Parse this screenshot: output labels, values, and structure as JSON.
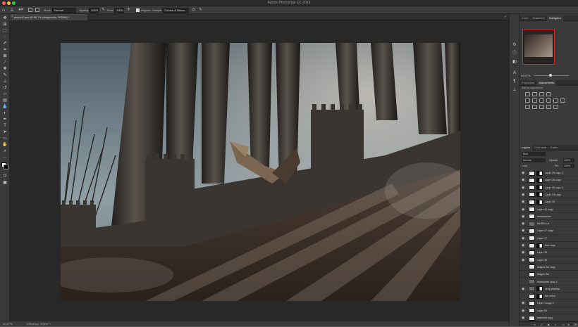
{
  "window": {
    "title": "Adobe Photoshop CC 2019",
    "traffic_colors": [
      "#ff5f57",
      "#febc2e",
      "#28c840"
    ]
  },
  "options_bar": {
    "mode_label": "Mode:",
    "mode_value": "Normal",
    "opacity_label": "Opacity:",
    "opacity_value": "100%",
    "flow_label": "Flow:",
    "flow_value": "100%",
    "aligned_label": "Aligned",
    "sample_label": "Sample:",
    "sample_value": "Current & Below"
  },
  "document": {
    "tab_label": "pinjolo2.psd @ 66.7% (dragoncito, RGB/8) *"
  },
  "status_bar": {
    "zoom": "66.67%",
    "info": "Efficiency: 100%*"
  },
  "tools": [
    "move-icon",
    "marquee-icon",
    "lasso-icon",
    "quick-select-icon",
    "crop-icon",
    "frame-icon",
    "eyedropper-icon",
    "healing-icon",
    "brush-icon",
    "clone-stamp-icon",
    "history-brush-icon",
    "eraser-icon",
    "gradient-icon",
    "blur-icon",
    "dodge-icon",
    "pen-icon",
    "type-icon",
    "path-select-icon",
    "shape-icon",
    "hand-icon",
    "zoom-icon",
    "more-icon"
  ],
  "right_strip_icons": [
    "history-icon",
    "info-icon",
    "properties-icon",
    "character-icon",
    "paragraph-icon",
    "clone-source-icon"
  ],
  "top_panel": {
    "tabs": [
      "Color",
      "Swatches",
      "Navigator"
    ],
    "active": "Navigator",
    "zoom": "66.67%"
  },
  "mid_panel": {
    "tabs": [
      "Properties",
      "Adjustments"
    ],
    "active": "Adjustments",
    "hint": "Add an adjustment"
  },
  "layers_panel": {
    "tabs": [
      "Layers",
      "Channels",
      "Paths"
    ],
    "active": "Layers",
    "filter_label": "Kind",
    "blend_mode": "Normal",
    "opacity_label": "Opacity:",
    "opacity_value": "100%",
    "lock_label": "Lock:",
    "fill_label": "Fill:",
    "fill_value": "100%",
    "layers": [
      {
        "name": "Layer 25 copy 2",
        "eye": true,
        "mask": true
      },
      {
        "name": "Layer 26 copy",
        "eye": true,
        "mask": true
      },
      {
        "name": "Layer 26 copy 2",
        "eye": true,
        "mask": true
      },
      {
        "name": "Layer 24 copy",
        "eye": true,
        "mask": true
      },
      {
        "name": "Layer 24",
        "eye": true,
        "mask": true
      },
      {
        "name": "Layer 41 copy",
        "eye": true,
        "mask": false
      },
      {
        "name": "mesadocher",
        "eye": true,
        "mask": false
      },
      {
        "name": "MURALLA",
        "eye": true,
        "mask": false,
        "group": true
      },
      {
        "name": "Layer 17 copy",
        "eye": true,
        "mask": false
      },
      {
        "name": "Layer 17",
        "eye": true,
        "mask": false
      },
      {
        "name": "fore copy",
        "eye": true,
        "mask": true
      },
      {
        "name": "Layer 33",
        "eye": true,
        "mask": false
      },
      {
        "name": "Layer 40",
        "eye": true,
        "mask": false
      },
      {
        "name": "dragon fire copy",
        "eye": false,
        "mask": false
      },
      {
        "name": "dragon fire",
        "eye": false,
        "mask": false
      },
      {
        "name": "estandarte copy 4",
        "eye": false,
        "mask": false,
        "group": true
      },
      {
        "name": "verig shadow",
        "eye": true,
        "mask": true,
        "group": true
      },
      {
        "name": "fire rellen",
        "eye": false,
        "mask": true
      },
      {
        "name": "Layer 1 copy 4",
        "eye": true,
        "mask": false
      },
      {
        "name": "Layer 26",
        "eye": true,
        "mask": false
      },
      {
        "name": "batemila copy",
        "eye": true,
        "mask": false
      }
    ]
  }
}
